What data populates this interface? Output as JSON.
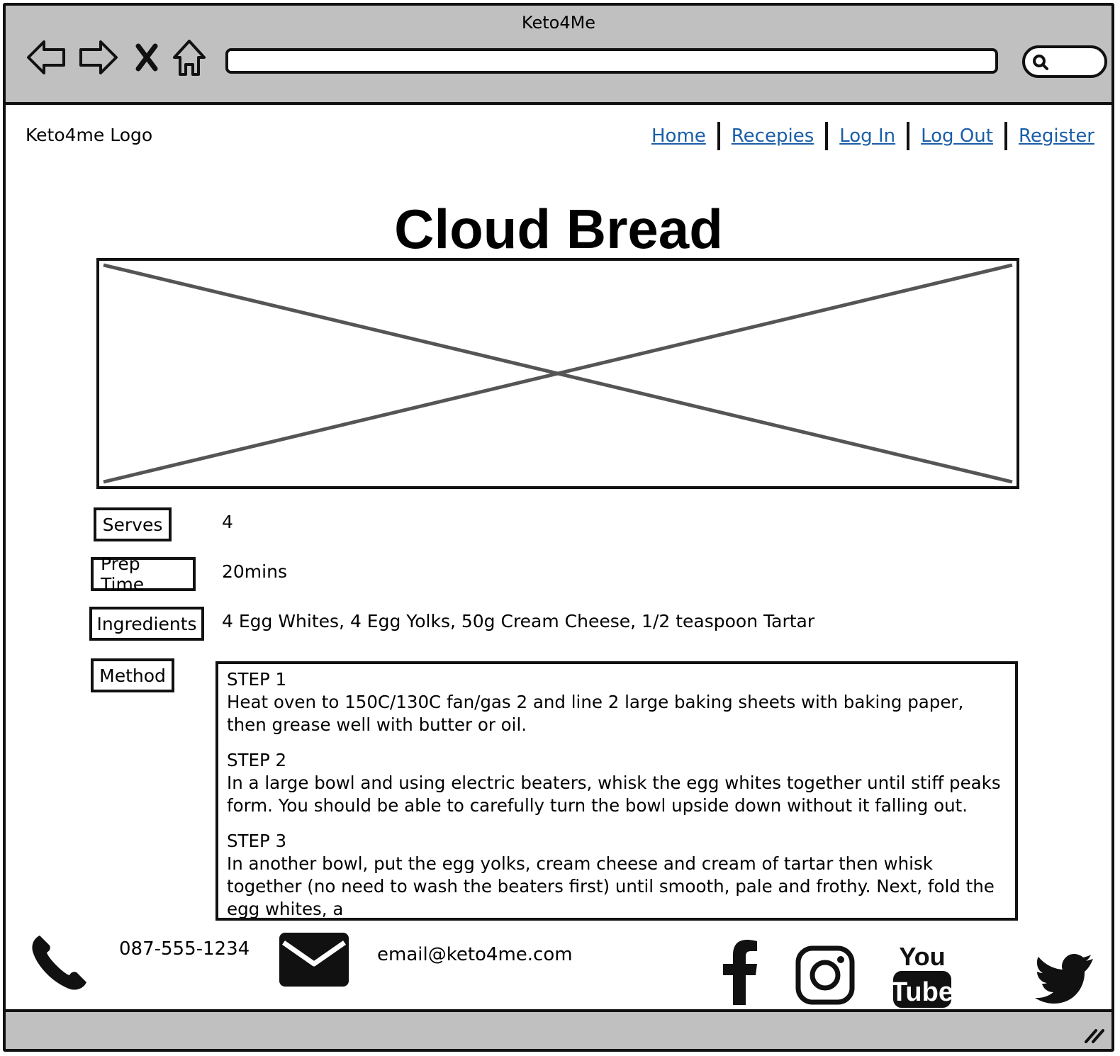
{
  "window": {
    "title": "Keto4Me"
  },
  "header": {
    "logo": "Keto4me Logo"
  },
  "nav": {
    "items": [
      "Home",
      "Recepies",
      "Log In",
      "Log Out",
      "Register"
    ]
  },
  "recipe": {
    "title": "Cloud Bread",
    "fields": [
      {
        "label": "Serves",
        "value": "4"
      },
      {
        "label": "Prep Time",
        "value": "20mins"
      },
      {
        "label": "Ingredients",
        "value": "4 Egg Whites, 4 Egg Yolks, 50g Cream Cheese, 1/2 teaspoon Tartar"
      }
    ],
    "method_label": "Method",
    "steps": [
      {
        "title": "STEP 1",
        "text": "Heat oven to 150C/130C fan/gas 2 and line 2 large baking sheets with baking paper, then grease well with butter or oil."
      },
      {
        "title": "STEP 2",
        "text": "In a large bowl and using electric beaters, whisk the egg whites together until stiff peaks form. You should be able to carefully turn the bowl upside down without it falling out."
      },
      {
        "title": "STEP 3",
        "text": "In another bowl, put the egg yolks, cream cheese and cream of tartar then whisk together (no need to wash the beaters first) until smooth, pale and frothy. Next, fold the egg whites, a"
      }
    ]
  },
  "footer": {
    "phone": "087-555-1234",
    "email": "email@keto4me.com",
    "social": [
      "facebook-icon",
      "instagram-icon",
      "youtube-icon",
      "twitter-icon"
    ]
  },
  "icons": [
    "back-arrow-icon",
    "forward-arrow-icon",
    "close-icon",
    "home-icon",
    "search-icon",
    "phone-icon",
    "envelope-icon",
    "resize-grip-icon"
  ]
}
